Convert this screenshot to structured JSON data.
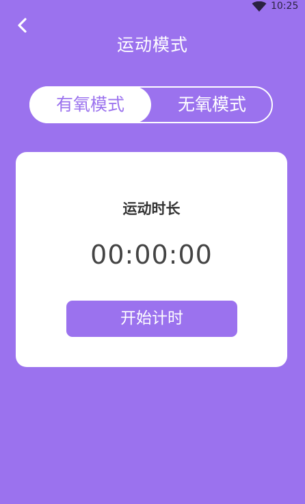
{
  "status_bar": {
    "time": "10:25",
    "wifi_icon": "wifi-icon"
  },
  "header": {
    "back_icon": "chevron-left-icon",
    "title": "运动模式"
  },
  "mode_tabs": {
    "options": [
      {
        "label": "有氧模式",
        "selected": true
      },
      {
        "label": "无氧模式",
        "selected": false
      }
    ]
  },
  "timer_card": {
    "heading": "运动时长",
    "elapsed": "00:00:00",
    "start_label": "开始计时"
  },
  "colors": {
    "background": "#9b72ee",
    "card": "#ffffff",
    "accent": "#9b72ee",
    "text_dark": "#333333"
  }
}
